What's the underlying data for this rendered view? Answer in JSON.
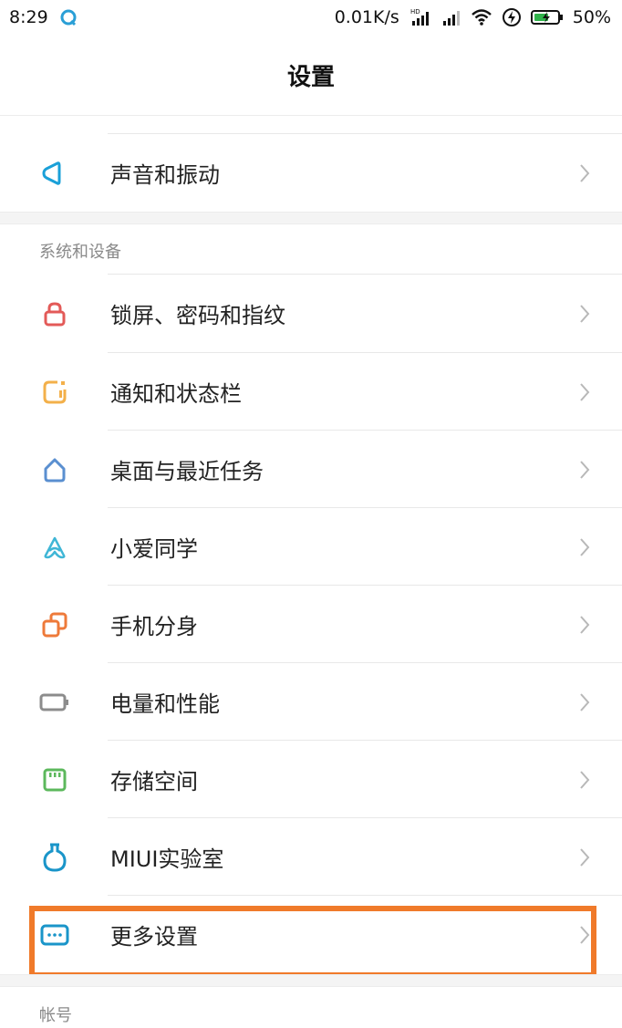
{
  "status": {
    "time": "8:29",
    "network_speed": "0.01K/s",
    "hd_badge": "HD",
    "battery": "50%"
  },
  "header": {
    "title": "设置"
  },
  "top_items": [
    {
      "label": "声音和振动",
      "icon": "sound-icon",
      "color": "#1aa0d8"
    }
  ],
  "sections": [
    {
      "title": "系统和设备",
      "items": [
        {
          "label": "锁屏、密码和指纹",
          "icon": "lock-icon",
          "color": "#e35a58"
        },
        {
          "label": "通知和状态栏",
          "icon": "notification-icon",
          "color": "#f3b04a"
        },
        {
          "label": "桌面与最近任务",
          "icon": "home-icon",
          "color": "#5a8fd0"
        },
        {
          "label": "小爱同学",
          "icon": "xiaoai-icon",
          "color": "#3fb6d6"
        },
        {
          "label": "手机分身",
          "icon": "second-space-icon",
          "color": "#ee7a3a"
        },
        {
          "label": "电量和性能",
          "icon": "battery-icon",
          "color": "#8c8c8c"
        },
        {
          "label": "存储空间",
          "icon": "storage-icon",
          "color": "#5cb85c"
        },
        {
          "label": "MIUI实验室",
          "icon": "lab-icon",
          "color": "#1a95c9"
        },
        {
          "label": "更多设置",
          "icon": "more-icon",
          "color": "#1a95c9"
        }
      ]
    },
    {
      "title": "帐号",
      "items": []
    }
  ],
  "highlight_color": "#f07a2a"
}
